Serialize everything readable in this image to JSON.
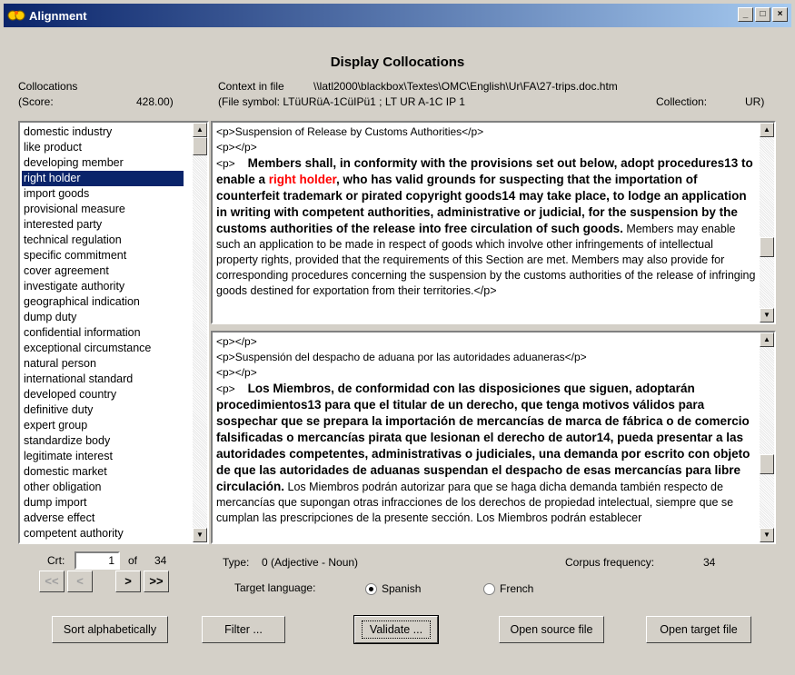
{
  "window": {
    "title": "Alignment"
  },
  "heading": "Display Collocations",
  "collocations": {
    "label": "Collocations",
    "score_label": "(Score:",
    "score_value": "428.00)",
    "items": [
      "domestic industry",
      "like product",
      "developing member",
      "right holder",
      "import goods",
      "provisional measure",
      "interested party",
      "technical regulation",
      "specific commitment",
      "cover agreement",
      "investigate authority",
      "geographical indication",
      "dump duty",
      "confidential information",
      "exceptional circumstance",
      "natural person",
      "international standard",
      "developed country",
      "definitive duty",
      "expert group",
      "standardize body",
      "legitimate interest",
      "domestic market",
      "other obligation",
      "dump import",
      "adverse effect",
      "competent authority"
    ],
    "selected_index": 3
  },
  "context": {
    "label": "Context in file",
    "path": "\\\\latl2000\\blackbox\\Textes\\OMC\\English\\Ur\\FA\\27-trips.doc.htm",
    "file_symbol": "(File symbol: LTüURüA-1CüIPü1 ; LT UR A-1C IP 1",
    "collection_label": "Collection:",
    "collection_value": "UR)"
  },
  "source_text": {
    "line1": "<p>Suspension of Release by Customs Authorities</p>",
    "line2": "<p></p>",
    "p_tag": "<p>",
    "bold_before": "Members shall, in conformity with the provisions set out below, adopt procedures13 to enable a ",
    "highlight": "right holder",
    "bold_after": ", who has valid grounds for suspecting that the importation of counterfeit trademark or pirated copyright goods14 may take place, to lodge an application in writing with competent authorities, administrative or judicial, for the suspension by the customs authorities of the release into free circulation of such goods.",
    "normal_after": "  Members may enable such an application to be made in respect of goods which involve other infringements of intellectual property rights, provided that the requirements of this Section are met.  Members may also provide for corresponding procedures concerning the suspension by the customs authorities of the release of infringing goods destined for exportation from their territories.</p>"
  },
  "target_text": {
    "line1": "<p></p>",
    "line2": "<p>Suspensión del despacho de aduana por las autoridades aduaneras</p>",
    "line3": "<p></p>",
    "p_tag": "<p>",
    "bold": "Los Miembros, de conformidad con las disposiciones que siguen, adoptarán procedimientos13 para que el titular de un derecho, que tenga motivos válidos para sospechar que se prepara la importación de mercancías de marca de fábrica o de comercio falsificadas o mercancías pirata que lesionan el derecho de autor14, pueda presentar a las autoridades competentes, administrativas o judiciales, una demanda por escrito con objeto de que las autoridades de aduanas suspendan el despacho de esas mercancías para libre circulación.",
    "normal": "  Los Miembros podrán autorizar para que se haga dicha demanda también respecto de mercancías que supongan otras infracciones de los derechos de propiedad intelectual, siempre que se cumplan las prescripciones de la presente sección. Los Miembros podrán establecer"
  },
  "nav": {
    "crt_label": "Crt:",
    "crt_value": "1",
    "of_label": "of",
    "total": "34",
    "first": "<<",
    "prev": "<",
    "next": ">",
    "last": ">>"
  },
  "info": {
    "type_label": "Type:",
    "type_value": "0 (Adjective - Noun)",
    "corpus_label": "Corpus frequency:",
    "corpus_value": "34",
    "target_lang_label": "Target language:",
    "lang_spanish": "Spanish",
    "lang_french": "French"
  },
  "buttons": {
    "sort": "Sort alphabetically",
    "filter": "Filter ...",
    "validate": "Validate ...",
    "open_source": "Open source file",
    "open_target": "Open target file"
  }
}
